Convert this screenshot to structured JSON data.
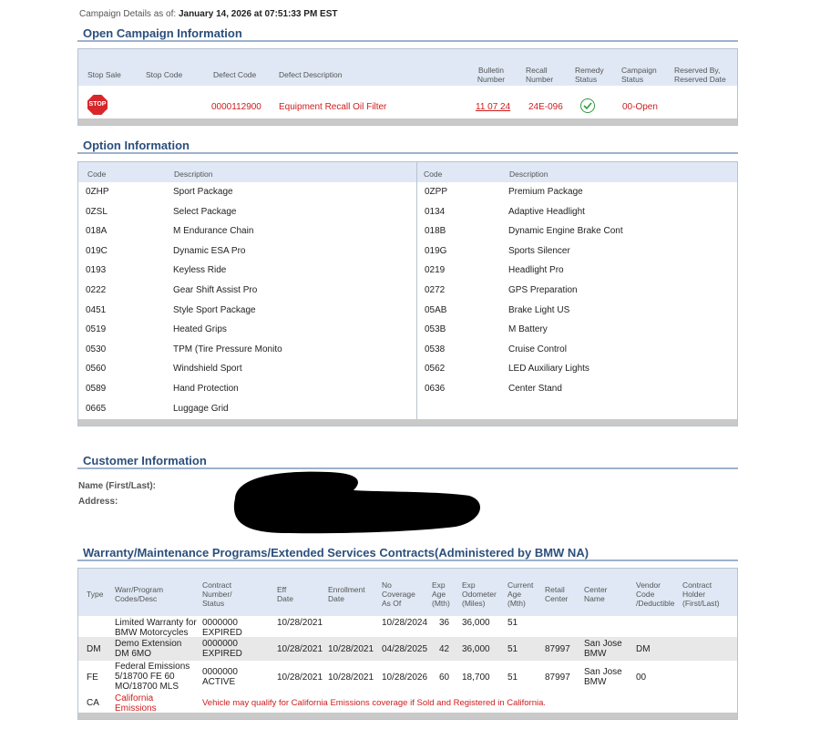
{
  "asof": {
    "label": "Campaign Details as of:",
    "value": "January 14, 2026 at 07:51:33 PM EST"
  },
  "campaign": {
    "title": "Open Campaign Information",
    "headers": {
      "stop_sale": "Stop Sale",
      "stop_code": "Stop Code",
      "defect_code": "Defect Code",
      "defect_desc": "Defect Description",
      "bulletin": "Bulletin Number",
      "recall": "Recall Number",
      "remedy": "Remedy Status",
      "status": "Campaign Status",
      "reserved": "Reserved By, Reserved Date"
    },
    "row": {
      "stop_icon_text": "STOP",
      "defect_code": "0000112900",
      "defect_desc": "Equipment Recall Oil Filter",
      "bulletin": "11 07 24",
      "recall": "24E-096",
      "remedy_icon": "check-circle-icon",
      "status": "00-Open"
    }
  },
  "options": {
    "title": "Option Information",
    "headers": {
      "code": "Code",
      "desc": "Description"
    },
    "left": [
      {
        "code": "0ZHP",
        "desc": "Sport Package"
      },
      {
        "code": "0ZSL",
        "desc": "Select Package"
      },
      {
        "code": "018A",
        "desc": "M Endurance Chain"
      },
      {
        "code": "019C",
        "desc": "Dynamic ESA Pro"
      },
      {
        "code": "0193",
        "desc": "Keyless Ride"
      },
      {
        "code": "0222",
        "desc": "Gear Shift Assist Pro"
      },
      {
        "code": "0451",
        "desc": "Style Sport Package"
      },
      {
        "code": "0519",
        "desc": "Heated Grips"
      },
      {
        "code": "0530",
        "desc": "TPM (Tire Pressure Monito"
      },
      {
        "code": "0560",
        "desc": "Windshield Sport"
      },
      {
        "code": "0589",
        "desc": "Hand Protection"
      },
      {
        "code": "0665",
        "desc": "Luggage Grid"
      }
    ],
    "right": [
      {
        "code": "0ZPP",
        "desc": "Premium Package"
      },
      {
        "code": "0134",
        "desc": "Adaptive Headlight"
      },
      {
        "code": "018B",
        "desc": "Dynamic Engine Brake Cont"
      },
      {
        "code": "019G",
        "desc": "Sports Silencer"
      },
      {
        "code": "0219",
        "desc": "Headlight Pro"
      },
      {
        "code": "0272",
        "desc": "GPS Preparation"
      },
      {
        "code": "05AB",
        "desc": "Brake Light US"
      },
      {
        "code": "053B",
        "desc": "M Battery"
      },
      {
        "code": "0538",
        "desc": "Cruise Control"
      },
      {
        "code": "0562",
        "desc": "LED Auxiliary Lights"
      },
      {
        "code": "0636",
        "desc": "Center Stand"
      }
    ]
  },
  "customer": {
    "title": "Customer Information",
    "name_label": "Name (First/Last):",
    "address_label": "Address:"
  },
  "warranty": {
    "title": "Warranty/Maintenance Programs/Extended Services Contracts(Administered by BMW NA)",
    "headers": {
      "type": "Type",
      "codes": "Warr/Program Codes/Desc",
      "contract": "Contract Number/ Status",
      "eff": "Eff Date",
      "enroll": "Enrollment Date",
      "nocov": "No Coverage As Of",
      "expage": "Exp Age (Mth)",
      "expodo": "Exp Odometer (Miles)",
      "curage": "Current Age (Mth)",
      "retail": "Retail Center",
      "center": "Center Name",
      "vendor": "Vendor Code /Deductible",
      "holder": "Contract Holder (First/Last)"
    },
    "rows": [
      {
        "type": "",
        "desc": "Limited Warranty for BMW Motorcycles",
        "contract": "0000000 EXPIRED",
        "eff": "10/28/2021",
        "enroll": "",
        "nocov": "10/28/2024",
        "expage": "36",
        "expodo": "36,000",
        "curage": "51",
        "retail": "",
        "center": "",
        "vendor": ""
      },
      {
        "type": "DM",
        "desc": "Demo Extension DM 6MO",
        "contract": "0000000 EXPIRED",
        "eff": "10/28/2021",
        "enroll": "10/28/2021",
        "nocov": "04/28/2025",
        "expage": "42",
        "expodo": "36,000",
        "curage": "51",
        "retail": "87997",
        "center": "San Jose BMW",
        "vendor": "DM"
      },
      {
        "type": "FE",
        "desc": "Federal Emissions 5/18700 FE 60 MO/18700 MLS",
        "contract": "0000000 ACTIVE",
        "eff": "10/28/2021",
        "enroll": "10/28/2021",
        "nocov": "10/28/2026",
        "expage": "60",
        "expodo": "18,700",
        "curage": "51",
        "retail": "87997",
        "center": "San Jose BMW",
        "vendor": "00"
      },
      {
        "type": "CA",
        "desc": "California Emissions",
        "note": "Vehicle may qualify for California Emissions coverage if Sold and Registered in California."
      }
    ]
  }
}
